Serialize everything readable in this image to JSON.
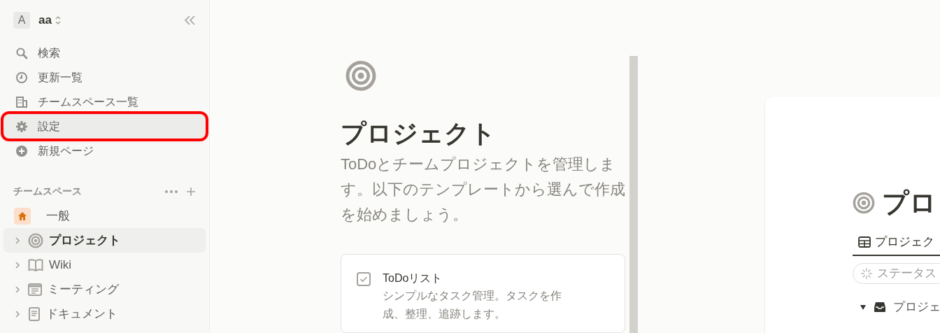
{
  "workspace": {
    "initial": "A",
    "name": "aa"
  },
  "nav": [
    {
      "label": "検索",
      "highlighted": false
    },
    {
      "label": "更新一覧",
      "highlighted": false
    },
    {
      "label": "チームスペース一覧",
      "highlighted": false
    },
    {
      "label": "設定",
      "highlighted": true
    },
    {
      "label": "新規ページ",
      "highlighted": false
    }
  ],
  "teamspaces": {
    "heading": "チームスペース",
    "items": [
      {
        "label": "一般",
        "selected": false,
        "expandable": false
      },
      {
        "label": "プロジェクト",
        "selected": true,
        "expandable": true
      },
      {
        "label": "Wiki",
        "selected": false,
        "expandable": true
      },
      {
        "label": "ミーティング",
        "selected": false,
        "expandable": true
      },
      {
        "label": "ドキュメント",
        "selected": false,
        "expandable": true
      }
    ]
  },
  "template": {
    "title": "プロジェクト",
    "description": "ToDoとチームプロジェクトを管理します。以下のテンプレートから選んで作成を始めましょう。",
    "options": [
      {
        "title": "ToDoリスト",
        "description": "シンプルなタスク管理。タスクを作成、整理、追跡します。"
      }
    ]
  },
  "preview": {
    "title": "プロ",
    "tab": "プロジェク",
    "filter": "ステータス",
    "group": "プロジェ"
  }
}
